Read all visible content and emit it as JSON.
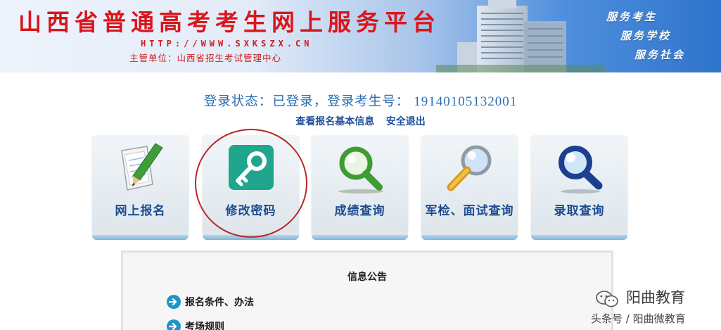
{
  "banner": {
    "title": "山西省普通高考考生网上服务平台",
    "url": "HTTP://WWW.SXKSZX.CN",
    "organizer": "主管单位：山西省招生考试管理中心",
    "mottos": [
      "服务考生",
      "服务学校",
      "服务社会"
    ]
  },
  "status": {
    "label": "登录状态：已登录，登录考生号：",
    "exam_number": "19140105132001"
  },
  "links": {
    "view_info": "查看报名基本信息",
    "logout": "安全退出"
  },
  "tiles": [
    {
      "label": "网上报名",
      "icon": "pen-paper-icon"
    },
    {
      "label": "修改密码",
      "icon": "key-icon"
    },
    {
      "label": "成绩查询",
      "icon": "magnifier-green-icon"
    },
    {
      "label": "军检、面试查询",
      "icon": "magnifier-gold-icon"
    },
    {
      "label": "录取查询",
      "icon": "magnifier-blue-icon"
    }
  ],
  "highlighted_tile": "修改密码",
  "notice": {
    "title": "信息公告",
    "items": [
      "报名条件、办法",
      "考场规则"
    ]
  },
  "watermark": {
    "name": "阳曲教育",
    "source": "头条号 / 阳曲微教育"
  },
  "colors": {
    "title_red": "#d9161c",
    "status_blue": "#2a6fb0",
    "tile_label_blue": "#1d4c8f",
    "key_tile_teal": "#1fa68c",
    "ring_red": "#b82727"
  }
}
